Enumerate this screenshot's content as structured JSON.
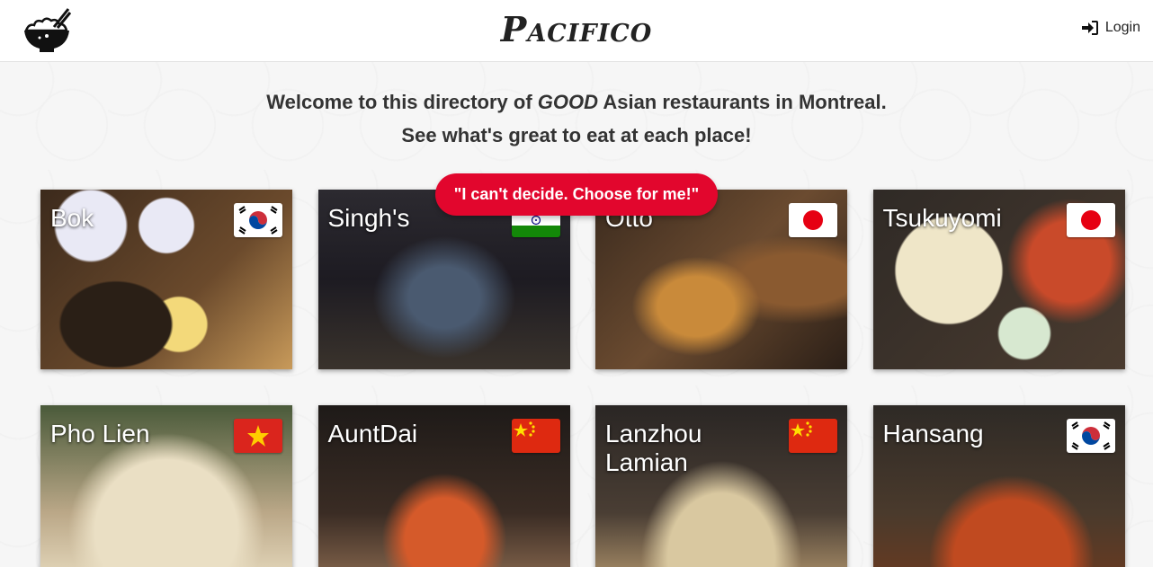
{
  "header": {
    "brand": "Pacifico",
    "login_label": "Login"
  },
  "welcome": {
    "line1_before": "Welcome to this directory of ",
    "line1_emph": "GOOD",
    "line1_after": " Asian restaurants in Montreal.",
    "line2": "See what's great to eat at each place!"
  },
  "choose_button": "\"I can't decide. Choose for me!\"",
  "colors": {
    "accent": "#e2062d"
  },
  "restaurants": [
    {
      "name": "Bok",
      "flag": "south-korea-flag"
    },
    {
      "name": "Singh's",
      "flag": "india-flag"
    },
    {
      "name": "Otto",
      "flag": "japan-flag"
    },
    {
      "name": "Tsukuyomi",
      "flag": "japan-flag"
    },
    {
      "name": "Pho Lien",
      "flag": "vietnam-flag"
    },
    {
      "name": "AuntDai",
      "flag": "china-flag"
    },
    {
      "name": "Lanzhou Lamian",
      "flag": "china-flag"
    },
    {
      "name": "Hansang",
      "flag": "south-korea-flag"
    }
  ]
}
